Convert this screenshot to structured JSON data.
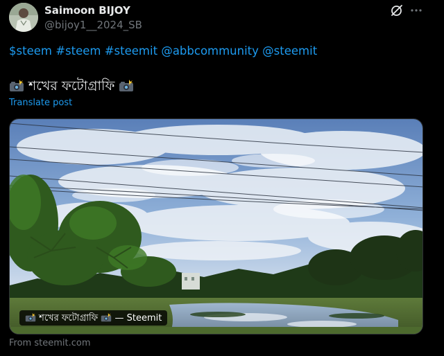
{
  "author": {
    "display_name": "Saimoon BIJOY",
    "handle": "@bijoy1__2024_SB"
  },
  "post": {
    "hashtags": [
      "$steem",
      "#steem",
      "#steemit",
      "@abbcommunity",
      "@steemit"
    ],
    "title": "শখের ফটোগ্রাফি",
    "translate_label": "Translate post"
  },
  "card": {
    "caption_title": "শখের ফটোগ্রাফি",
    "caption_source": "— Steemit",
    "source_label": "From steemit.com"
  },
  "icons": {
    "grok": "grok-icon",
    "more": "more-icon",
    "camera": "camera-flash-emoji-icon"
  },
  "colors": {
    "background": "#000000",
    "link": "#1d9bf0",
    "text": "#e7e9ea",
    "muted": "#71767b"
  }
}
